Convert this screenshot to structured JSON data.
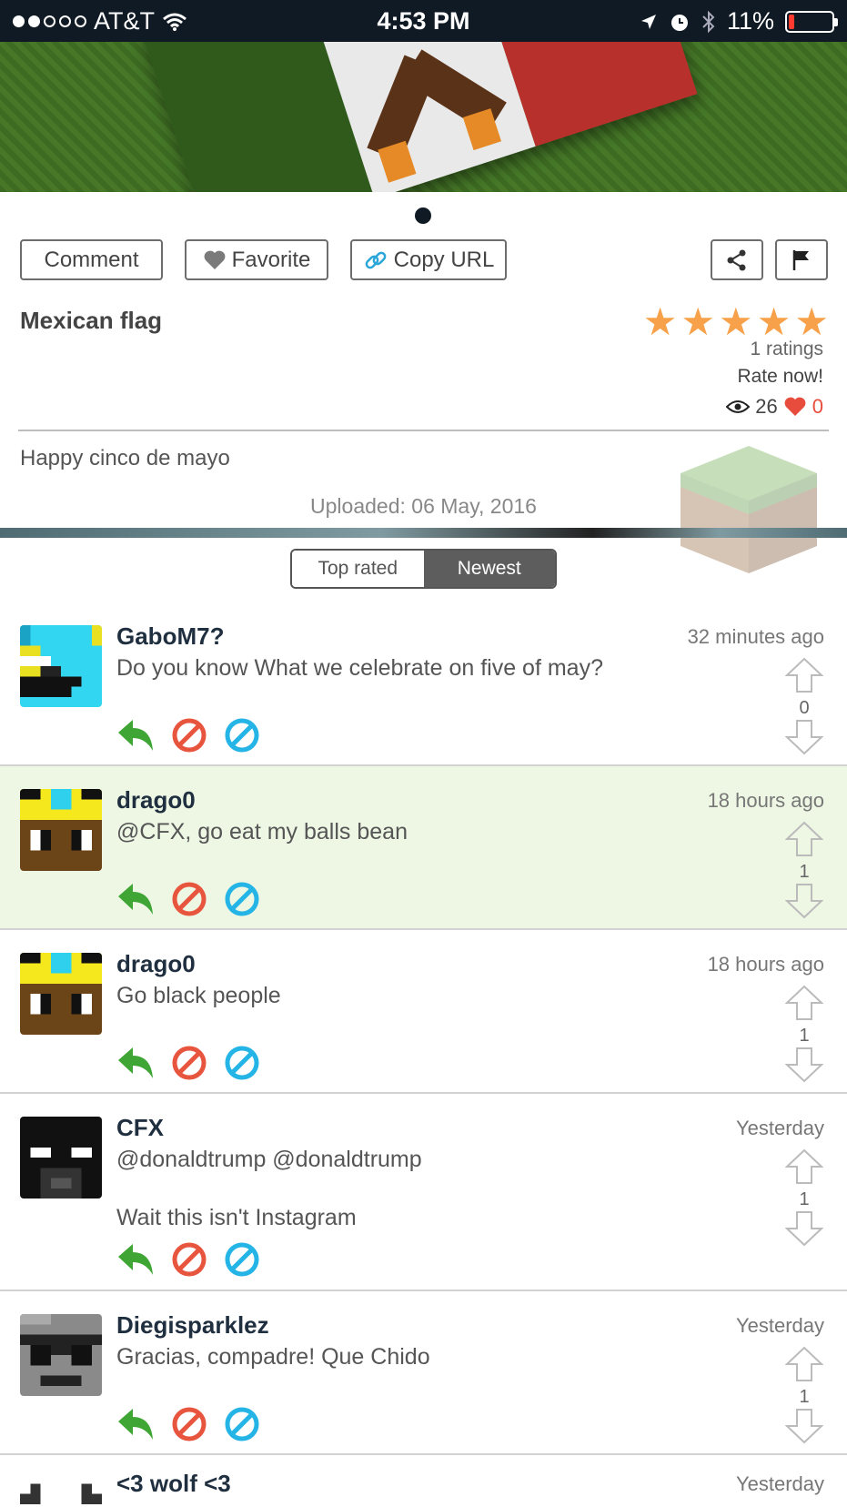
{
  "status_bar": {
    "carrier": "AT&T",
    "time": "4:53 PM",
    "battery": "11%"
  },
  "actions": {
    "comment": "Comment",
    "favorite": "Favorite",
    "copy_url": "Copy URL"
  },
  "post": {
    "title": "Mexican flag",
    "stars": 5,
    "ratings": "1 ratings",
    "rate_now": "Rate now!",
    "views": "26",
    "likes": "0",
    "description": "Happy cinco de mayo",
    "uploaded": "Uploaded: 06 May, 2016"
  },
  "sort_tabs": {
    "top_rated": "Top rated",
    "newest": "Newest",
    "selected": "Newest"
  },
  "comments": [
    {
      "user": "GaboM7?",
      "time": "32 minutes ago",
      "text": "Do you know What we celebrate on five of may?",
      "votes": "0"
    },
    {
      "user": "drago0",
      "time": "18 hours ago",
      "text": "@CFX, go eat my balls bean",
      "votes": "1",
      "highlighted": true
    },
    {
      "user": "drago0",
      "time": "18 hours ago",
      "text": "Go black people",
      "votes": "1"
    },
    {
      "user": "CFX",
      "time": "Yesterday",
      "text": "@donaldtrump @donaldtrump",
      "text2": "Wait this isn't Instagram",
      "votes": "1"
    },
    {
      "user": "Diegisparklez",
      "time": "Yesterday",
      "text": "Gracias, compadre! Que Chido",
      "votes": "1"
    },
    {
      "user": "<3 wolf <3",
      "time": "Yesterday"
    }
  ],
  "colors": {
    "reply": "#3fa535",
    "report": "#e8553e",
    "block": "#25b4e6",
    "star": "#f7a14a"
  }
}
